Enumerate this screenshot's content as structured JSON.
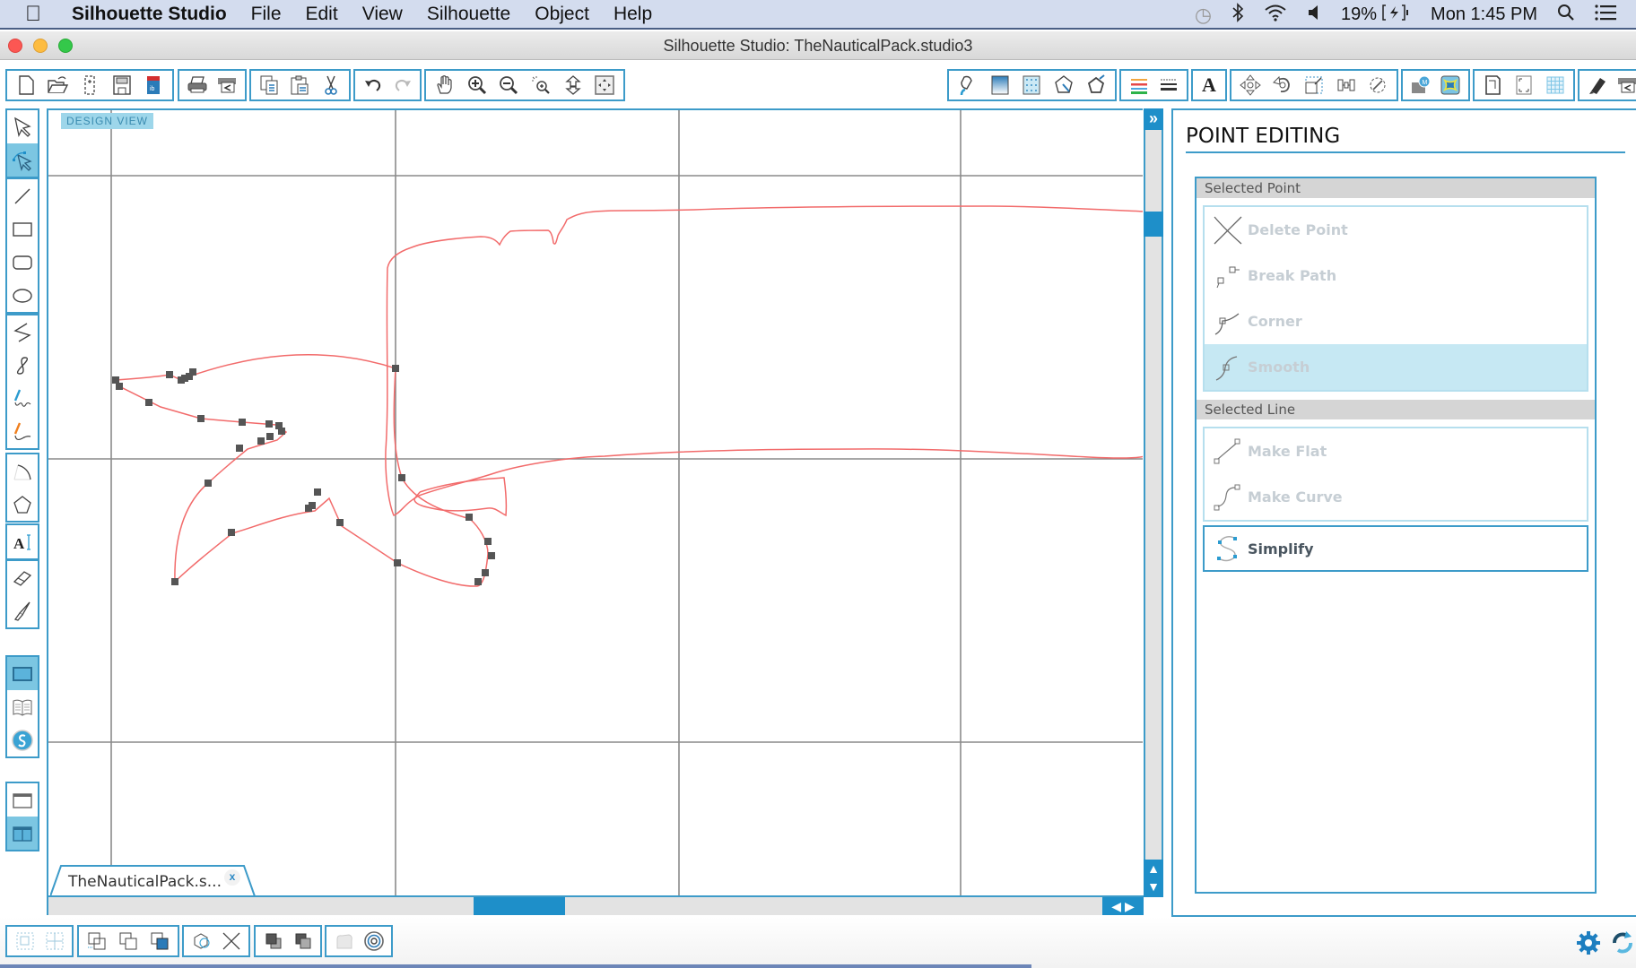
{
  "menubar": {
    "apple_icon": "apple-logo-icon",
    "app_name": "Silhouette Studio",
    "menus": [
      "File",
      "Edit",
      "View",
      "Silhouette",
      "Object",
      "Help"
    ],
    "status": {
      "time_machine_icon": "time-machine-icon",
      "bluetooth_icon": "bluetooth-icon",
      "wifi_icon": "wifi-icon",
      "volume_icon": "volume-icon",
      "battery": "19%",
      "battery_icon": "battery-charging-icon",
      "clock": "Mon 1:45 PM",
      "spotlight_icon": "spotlight-search-icon",
      "notification_icon": "notification-center-icon"
    }
  },
  "window": {
    "title": "Silhouette Studio: TheNauticalPack.studio3",
    "traffic_lights": {
      "close": "#fc5753",
      "minimize": "#fdbc40",
      "zoom": "#34c84a"
    }
  },
  "toolbar": {
    "groups": [
      [
        "new-document",
        "open-file",
        "open-library-file",
        "save",
        "save-to-sd-card"
      ],
      [
        "print",
        "print-and-cut"
      ],
      [
        "copy",
        "paste",
        "cut"
      ],
      [
        "undo",
        "redo"
      ],
      [
        "pan-hand",
        "zoom-in",
        "zoom-out",
        "zoom-selection",
        "drag-zoom",
        "fit-to-page"
      ],
      [
        "fill-color",
        "gradient",
        "fill-pattern",
        "line-color-panel",
        "line-style"
      ],
      [
        "line-color-rainbow",
        "line-style-dashed"
      ],
      [
        "text-style"
      ],
      [
        "transform-move",
        "rotate",
        "scale",
        "align",
        "replicate"
      ],
      [
        "modify-offset",
        "trace"
      ],
      [
        "page-setup",
        "registration-marks",
        "grid"
      ],
      [
        "sketch",
        "send-to-silhouette"
      ]
    ]
  },
  "left_tools": {
    "groups": [
      [
        "select-pointer",
        "point-edit"
      ],
      [
        "line-tool",
        "rectangle-tool",
        "rounded-rectangle-tool",
        "ellipse-tool"
      ],
      [
        "polygon-tool",
        "curve-tool",
        "freehand-tool",
        "smooth-freehand-tool"
      ],
      [
        "arc-tool",
        "regular-polygon-tool"
      ],
      [
        "text-tool"
      ],
      [
        "eraser-tool",
        "knife-tool"
      ],
      [
        "design-view",
        "library-view",
        "online-store"
      ],
      [
        "single-panel-view",
        "split-panel-view"
      ]
    ],
    "active": [
      "point-edit",
      "design-view",
      "split-panel-view"
    ]
  },
  "canvas": {
    "view_label": "DESIGN VIEW",
    "document_tab": "TheNauticalPack.s...",
    "document_tab_close": "x",
    "path_color": "#f26b6b",
    "point_color": "#555555"
  },
  "scroll": {
    "vertical_expand": "»",
    "vertical_up": "▲",
    "vertical_down": "▼",
    "horizontal_left": "◀",
    "horizontal_right": "▶"
  },
  "panel": {
    "title": "POINT EDITING",
    "selected_point": {
      "heading": "Selected Point",
      "buttons": [
        {
          "label": "Delete Point",
          "icon": "delete-point-icon",
          "enabled": false
        },
        {
          "label": "Break Path",
          "icon": "break-path-icon",
          "enabled": false
        },
        {
          "label": "Corner",
          "icon": "corner-point-icon",
          "enabled": false
        },
        {
          "label": "Smooth",
          "icon": "smooth-point-icon",
          "enabled": false,
          "highlighted": true
        }
      ]
    },
    "selected_line": {
      "heading": "Selected Line",
      "buttons": [
        {
          "label": "Make Flat",
          "icon": "make-flat-icon",
          "enabled": false
        },
        {
          "label": "Make Curve",
          "icon": "make-curve-icon",
          "enabled": false
        }
      ]
    },
    "simplify": {
      "label": "Simplify",
      "icon": "simplify-icon",
      "enabled": true
    }
  },
  "bottom_toolbar": {
    "groups": [
      [
        "group",
        "ungroup"
      ],
      [
        "make-compound-path",
        "release-compound-path-duplicate",
        "release-compound-path"
      ],
      [
        "weld-3d",
        "delete-x"
      ],
      [
        "bring-to-front",
        "send-to-back"
      ],
      [
        "fill-shape",
        "offset-target"
      ]
    ],
    "right_icons": [
      "settings-gear-icon",
      "sync-refresh-icon"
    ]
  },
  "colors": {
    "accent": "#3d9bc9",
    "accent_dark": "#1e8fc9",
    "highlight": "#c6e8f3",
    "menubar_bg": "#d3dcee"
  }
}
